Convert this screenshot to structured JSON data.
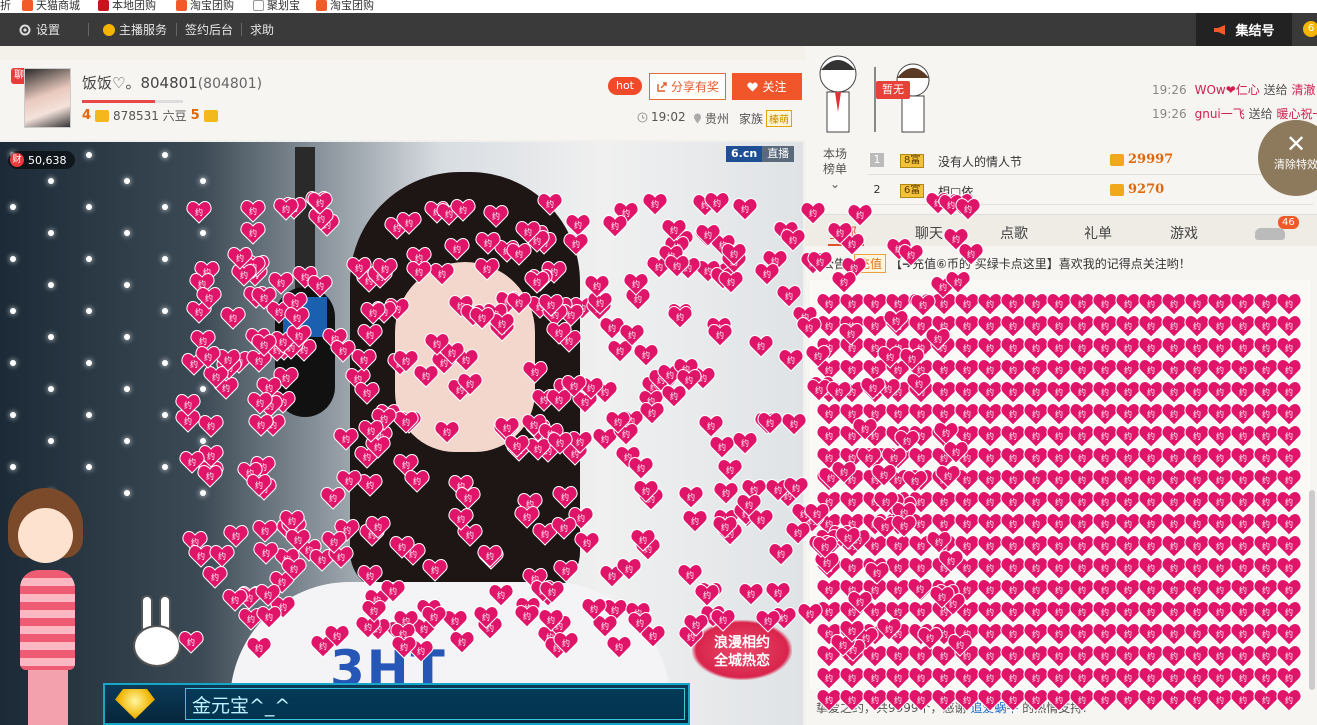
{
  "bookmarks": [
    {
      "label": "折",
      "color": "#ffffff"
    },
    {
      "label": "天猫商城",
      "color": "#f25a2a"
    },
    {
      "label": "本地团购",
      "color": "#c8151d"
    },
    {
      "label": "淘宝团购",
      "color": "#f25a2a"
    },
    {
      "label": "聚划宝",
      "color": "#ffffff"
    },
    {
      "label": "淘宝团购",
      "color": "#f25a2a"
    }
  ],
  "topnav": {
    "settings": "设置",
    "host_service": "主播服务",
    "sign_backend": "签约后台",
    "help": "求助",
    "jijiehao": "集结号",
    "coin": "6"
  },
  "host": {
    "chat_badge": "聊",
    "name": "饭饭♡。804801",
    "id": "(804801)",
    "level_left": "4",
    "beans": "878531 六豆",
    "level_right": "5",
    "level_progress": 0.72,
    "hot": "hot",
    "share": "分享有奖",
    "follow": "关注",
    "time": "19:02",
    "location": "贵州",
    "family_label": "家族",
    "family_tag": "榛萌"
  },
  "video": {
    "wealth_icon": "财",
    "wealth": "50,638",
    "logo": "6.cn",
    "live": "直播",
    "shirt_text": "3HT"
  },
  "banner": {
    "text": "金元宝^_^"
  },
  "promo": {
    "line1": "浪漫相约",
    "line2": "全城热恋"
  },
  "right": {
    "zanwu": "暂无",
    "gift_msgs": [
      {
        "time": "19:26",
        "user": "WOw❤仁心",
        "verb": "送给",
        "target": "清澈"
      },
      {
        "time": "19:26",
        "user": "gnui一飞",
        "verb": "送给",
        "target": "暖心祝一"
      }
    ],
    "clear_fx": "清除特效",
    "rank_side": [
      "本场",
      "榜单"
    ],
    "ranks": [
      {
        "num": "1",
        "badge": "8富",
        "name": "没有人的情人节",
        "score": "29997"
      },
      {
        "num": "2",
        "badge": "6富",
        "name": "相□依",
        "score": "9270"
      }
    ],
    "tabs": [
      "全部",
      "聊天",
      "点歌",
      "礼单",
      "游戏"
    ],
    "tab_badge": "46",
    "notice_prefix": "公告:",
    "recharge": "充值",
    "notice_text": "【➔充值⑥币的 买绿卡点这里】喜欢我的记得点关注哟！",
    "footer_prefix": "挚爱之约，共9999个，感谢",
    "footer_user": "追爱蜗牛",
    "footer_suffix": "的热情支持!"
  },
  "colors": {
    "heart": "#e0156a",
    "accent": "#f0562a",
    "nav": "#3a3a3a"
  }
}
